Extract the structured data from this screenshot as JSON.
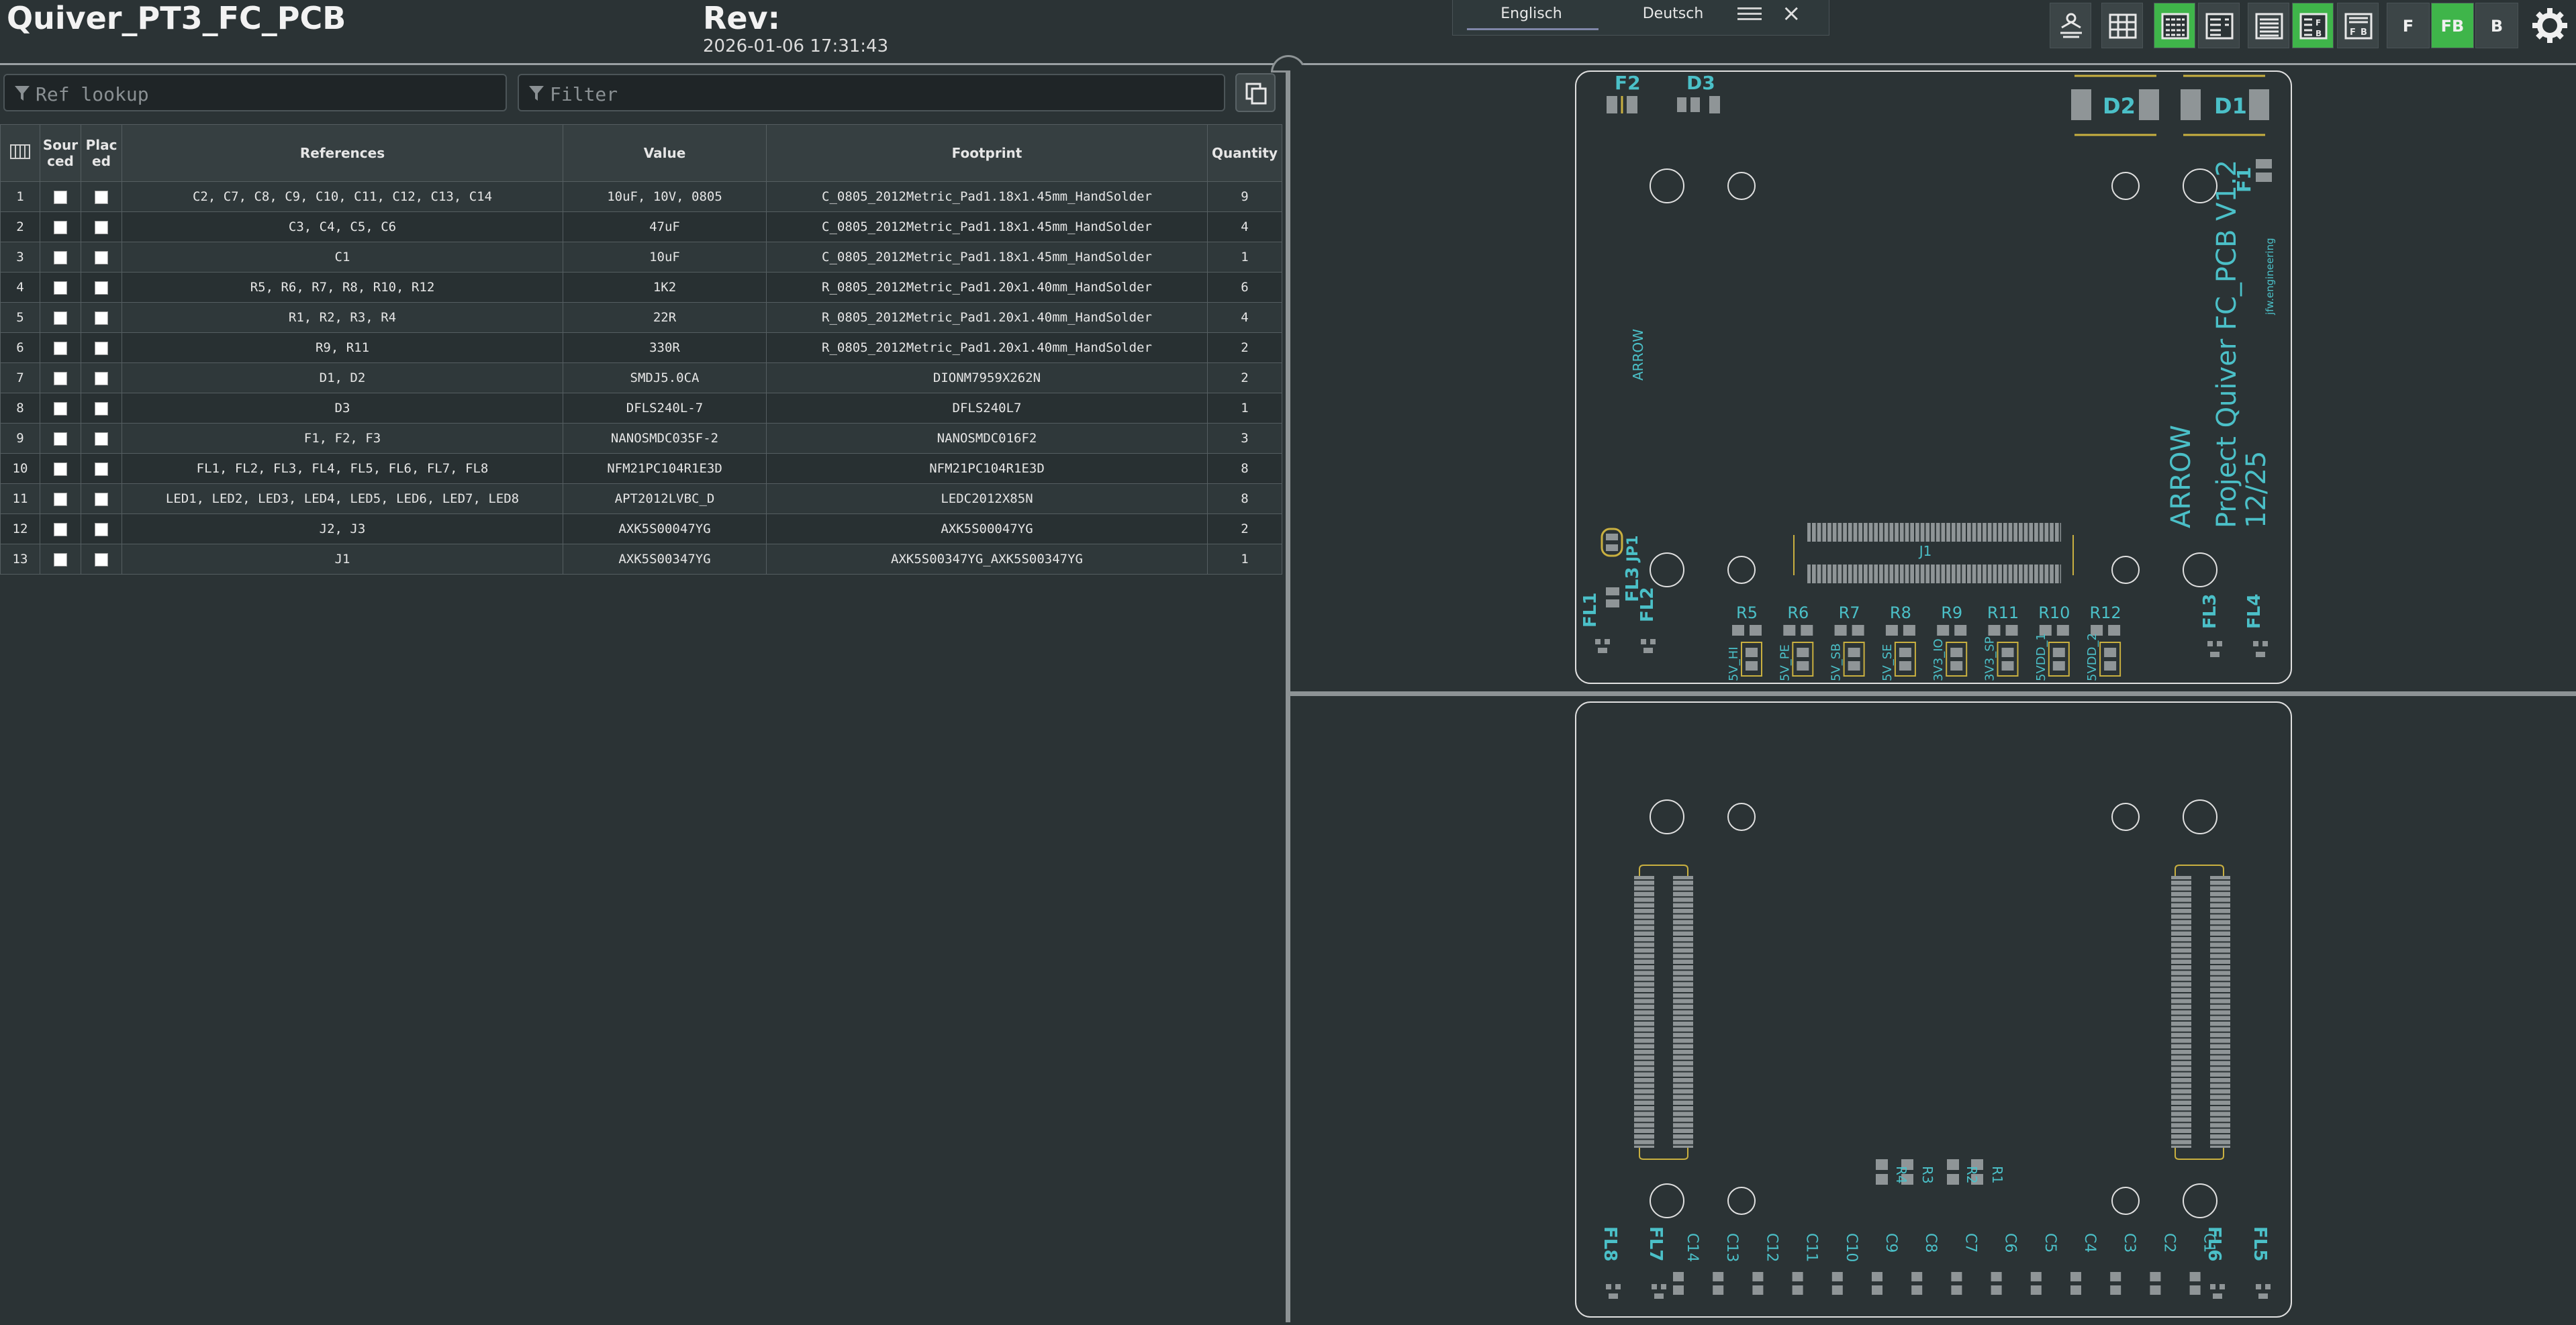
{
  "app": {
    "title": "Quiver_PT3_FC_PCB",
    "rev_label": "Rev:",
    "rev_date": "2026-01-06 17:31:43"
  },
  "language": {
    "options": [
      "Englisch",
      "Deutsch"
    ],
    "selected": "Englisch",
    "menu_icon": "hamburger-icon",
    "close_icon": "close-icon"
  },
  "toolbar": {
    "buttons": [
      {
        "name": "dark-mode-icon",
        "active": false
      },
      {
        "name": "grid-icon",
        "active": false
      },
      {
        "name": "bom-only-icon",
        "active": true
      },
      {
        "name": "bom-left-drawings-right-icon",
        "active": true
      },
      {
        "name": "bom-top-icon",
        "active": false
      },
      {
        "name": "bom-left-fb-icon",
        "active": true
      },
      {
        "name": "bom-top-fb-icon",
        "active": false
      }
    ],
    "layer_buttons": [
      "F",
      "FB",
      "B"
    ],
    "layer_selected": "FB",
    "settings_icon": "gear-icon"
  },
  "search": {
    "ref_lookup_placeholder": "Ref lookup",
    "filter_placeholder": "Filter"
  },
  "colors": {
    "background": "#2b3335",
    "accent_green": "#3fb54a",
    "silkscreen": "#4bc0c8",
    "pad": "#8f9597",
    "fab": "#c9b040"
  },
  "bom": {
    "headers": {
      "cols": "",
      "sourced": "Sour ced",
      "placed": "Plac ed",
      "references": "References",
      "value": "Value",
      "footprint": "Footprint",
      "quantity": "Quantity"
    },
    "rows": [
      {
        "n": "1",
        "refs": "C2, C7, C8, C9, C10, C11, C12, C13, C14",
        "value": "10uF, 10V, 0805",
        "footprint": "C_0805_2012Metric_Pad1.18x1.45mm_HandSolder",
        "qty": "9"
      },
      {
        "n": "2",
        "refs": "C3, C4, C5, C6",
        "value": "47uF",
        "footprint": "C_0805_2012Metric_Pad1.18x1.45mm_HandSolder",
        "qty": "4"
      },
      {
        "n": "3",
        "refs": "C1",
        "value": "10uF",
        "footprint": "C_0805_2012Metric_Pad1.18x1.45mm_HandSolder",
        "qty": "1"
      },
      {
        "n": "4",
        "refs": "R5, R6, R7, R8, R10, R12",
        "value": "1K2",
        "footprint": "R_0805_2012Metric_Pad1.20x1.40mm_HandSolder",
        "qty": "6"
      },
      {
        "n": "5",
        "refs": "R1, R2, R3, R4",
        "value": "22R",
        "footprint": "R_0805_2012Metric_Pad1.20x1.40mm_HandSolder",
        "qty": "4"
      },
      {
        "n": "6",
        "refs": "R9, R11",
        "value": "330R",
        "footprint": "R_0805_2012Metric_Pad1.20x1.40mm_HandSolder",
        "qty": "2"
      },
      {
        "n": "7",
        "refs": "D1, D2",
        "value": "SMDJ5.0CA",
        "footprint": "DIONM7959X262N",
        "qty": "2"
      },
      {
        "n": "8",
        "refs": "D3",
        "value": "DFLS240L-7",
        "footprint": "DFLS240L7",
        "qty": "1"
      },
      {
        "n": "9",
        "refs": "F1, F2, F3",
        "value": "NANOSMDC035F-2",
        "footprint": "NANOSMDC016F2",
        "qty": "3"
      },
      {
        "n": "10",
        "refs": "FL1, FL2, FL3, FL4, FL5, FL6, FL7, FL8",
        "value": "NFM21PC104R1E3D",
        "footprint": "NFM21PC104R1E3D",
        "qty": "8"
      },
      {
        "n": "11",
        "refs": "LED1, LED2, LED3, LED4, LED5, LED6, LED7, LED8",
        "value": "APT2012LVBC_D",
        "footprint": "LEDC2012X85N",
        "qty": "8"
      },
      {
        "n": "12",
        "refs": "J2, J3",
        "value": "AXK5S00047YG",
        "footprint": "AXK5S00047YG",
        "qty": "2"
      },
      {
        "n": "13",
        "refs": "J1",
        "value": "AXK5S00347YG",
        "footprint": "AXK5S00347YG_AXK5S00347YG",
        "qty": "1"
      }
    ]
  },
  "pcb_front": {
    "labels": {
      "f2": "F2",
      "d3": "D3",
      "d2": "D2",
      "d1": "D1",
      "f1": "F1",
      "arrow_small": "ARROW",
      "jfw": "jfw.engineering",
      "project": "Project Quiver FC_PCB V1.2",
      "arrow_big": "ARROW",
      "date": "12/25",
      "jp1": "JP1",
      "j1": "J1",
      "fl1": "FL1",
      "fl2": "FL2",
      "fl3": "FL3",
      "fl3b": "FL3",
      "fl4": "FL4"
    },
    "resistors": [
      "R5",
      "R6",
      "R7",
      "R8",
      "R9",
      "R11",
      "R10",
      "R12"
    ],
    "leds": [
      "5V_HI",
      "5V_PE",
      "5V_SB",
      "5V_SE",
      "3V3_IO",
      "3V3_SP",
      "5VDD_1",
      "5VDD_2"
    ]
  },
  "pcb_back": {
    "labels": {
      "r4": "R4",
      "r3": "R3",
      "r2": "R2",
      "r1": "R1",
      "fl8": "FL8",
      "fl7": "FL7",
      "fl6": "FL6",
      "fl5": "FL5"
    },
    "caps": [
      "C14",
      "C13",
      "C12",
      "C11",
      "C10",
      "C9",
      "C8",
      "C7",
      "C6",
      "C5",
      "C4",
      "C3",
      "C2",
      "C1"
    ]
  }
}
